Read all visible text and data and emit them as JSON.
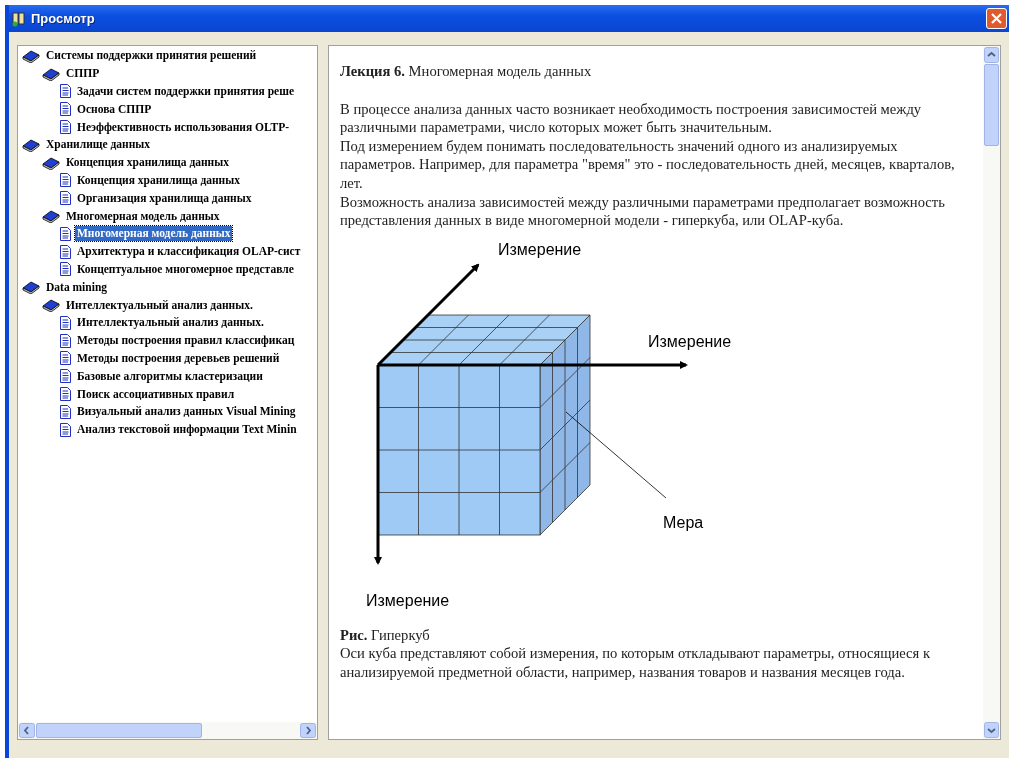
{
  "window": {
    "title": "Просмотр"
  },
  "tree": [
    {
      "label": "Системы поддержки принятия решений",
      "kind": "book",
      "selected": false,
      "children": [
        {
          "label": "СППР",
          "kind": "book",
          "selected": false,
          "children": [
            {
              "label": "Задачи систем поддержки принятия реше",
              "kind": "page",
              "selected": false
            },
            {
              "label": "Основа СППР",
              "kind": "page",
              "selected": false
            },
            {
              "label": "Неэффективность использования OLTP-",
              "kind": "page",
              "selected": false
            }
          ]
        }
      ]
    },
    {
      "label": "Хранилище данных",
      "kind": "book",
      "selected": false,
      "children": [
        {
          "label": "Концепция хранилища данных",
          "kind": "book",
          "selected": false,
          "children": [
            {
              "label": "Концепция хранилища данных",
              "kind": "page",
              "selected": false
            },
            {
              "label": "Организация хранилища данных",
              "kind": "page",
              "selected": false
            }
          ]
        },
        {
          "label": "Многомерная модель данных",
          "kind": "book",
          "selected": false,
          "children": [
            {
              "label": "Многомерная модель данных",
              "kind": "page",
              "selected": true
            },
            {
              "label": "Архитектура и классификация OLAP-сист",
              "kind": "page",
              "selected": false
            },
            {
              "label": "Концептуальное многомерное представле",
              "kind": "page",
              "selected": false
            }
          ]
        }
      ]
    },
    {
      "label": "Data mining",
      "kind": "book",
      "selected": false,
      "children": [
        {
          "label": "Интеллектуальный анализ данных.",
          "kind": "book",
          "selected": false,
          "children": [
            {
              "label": "Интеллектуальный анализ данных.",
              "kind": "page",
              "selected": false
            },
            {
              "label": "Методы построения правил классификац",
              "kind": "page",
              "selected": false
            },
            {
              "label": "Методы построения деревьев решений",
              "kind": "page",
              "selected": false
            },
            {
              "label": "Базовые алгоритмы кластеризации",
              "kind": "page",
              "selected": false
            },
            {
              "label": "Поиск ассоциативных правил",
              "kind": "page",
              "selected": false
            },
            {
              "label": "Визуальный анализ данных Visual Mining",
              "kind": "page",
              "selected": false
            },
            {
              "label": "Анализ текстовой информации Text Minin",
              "kind": "page",
              "selected": false
            }
          ]
        }
      ]
    }
  ],
  "content": {
    "heading": "**Лекция 6.** Многомерная модель данных",
    "paragraphs": [
      "В процессе анализа данных часто возникает необходимость построения зависимостей между различными параметрами, число которых может быть значительным.",
      "Под измерением будем понимать последовательность значений одного из анализируемых параметров. Например, для параметра \"время\" это - последовательность дней, месяцев, кварталов, лет.",
      "Возможность анализа зависимостей между различными параметрами предполагает возможность представления данных в виде многомерной модели - гиперкуба, или OLAP-куба."
    ],
    "figure": {
      "axis_labels": [
        "Измерение",
        "Измерение",
        "Измерение"
      ],
      "measure_label": "Мера"
    },
    "caption": "**Рис.** Гиперкуб",
    "closing": "Оси куба представляют собой измерения, по которым откладывают параметры, относящиеся к анализируемой предметной области, например, названия товаров и названия месяцев года."
  }
}
